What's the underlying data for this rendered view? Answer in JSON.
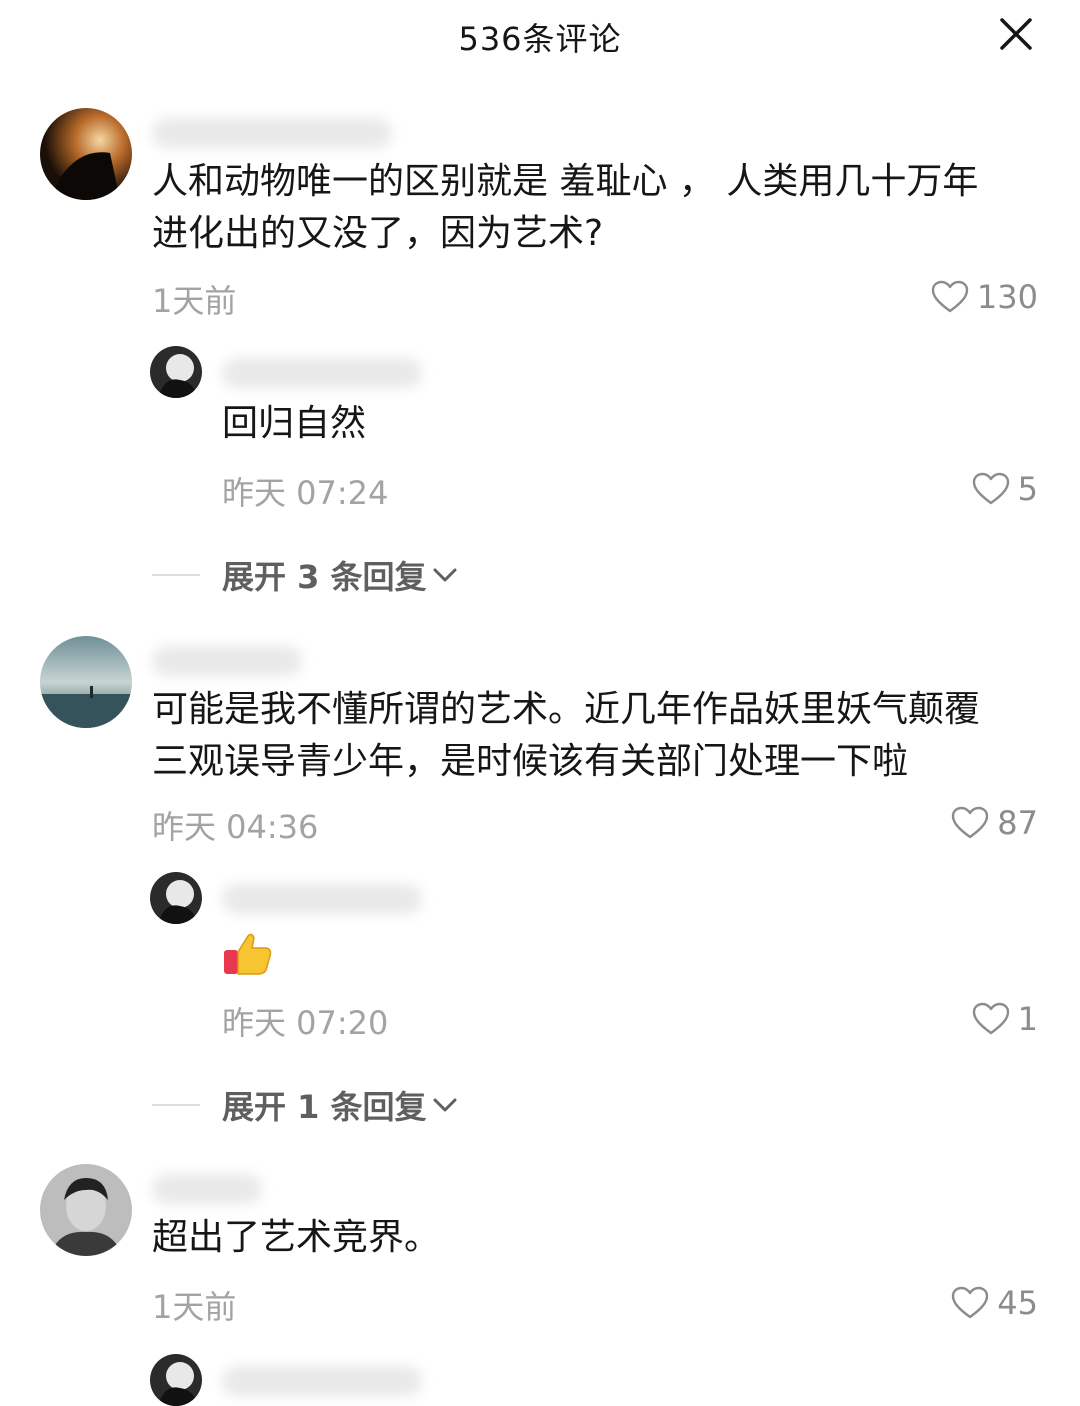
{
  "header": {
    "title": "536条评论",
    "close_icon": "close-icon"
  },
  "comments": [
    {
      "text_lines": [
        "人和动物唯一的区别就是 羞耻心 ， 人类用几十万年",
        "进化出的又没了，因为艺术?"
      ],
      "time": "1天前",
      "likes": "130",
      "reply": {
        "text": "回归自然",
        "time": "昨天 07:24",
        "likes": "5"
      },
      "expand_label": "展开 3 条回复"
    },
    {
      "text_lines": [
        "可能是我不懂所谓的艺术。近几年作品妖里妖气颠覆",
        "三观误导青少年，是时候该有关部门处理一下啦"
      ],
      "time": "昨天 04:36",
      "likes": "87",
      "reply": {
        "emoji": "thumbs-up-icon",
        "time": "昨天 07:20",
        "likes": "1"
      },
      "expand_label": "展开 1 条回复"
    },
    {
      "text_lines": [
        "超出了艺术竞界。"
      ],
      "time": "1天前",
      "likes": "45"
    }
  ],
  "colors": {
    "text": "#161616",
    "meta": "#a3a3a3",
    "like": "#8c8c8c",
    "expand": "#5f5f5f"
  }
}
